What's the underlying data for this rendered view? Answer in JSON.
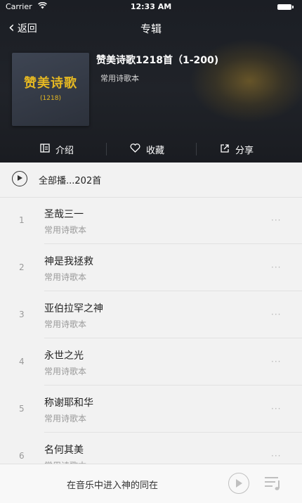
{
  "status": {
    "carrier": "Carrier",
    "time": "12:33 AM",
    "wifi_icon": "wifi-icon",
    "battery_icon": "battery-icon"
  },
  "nav": {
    "back_label": "返回",
    "title": "专辑"
  },
  "album": {
    "cover_title": "赞美诗歌",
    "cover_sub": "(1218)",
    "title": "赞美诗歌1218首（1-200)",
    "author": "常用诗歌本"
  },
  "actions": [
    {
      "label": "介绍",
      "icon": "book-icon"
    },
    {
      "label": "收藏",
      "icon": "heart-icon"
    },
    {
      "label": "分享",
      "icon": "share-icon"
    }
  ],
  "playall": {
    "label": "全部播...202首"
  },
  "songs": [
    {
      "num": "1",
      "title": "圣哉三一",
      "sub": "常用诗歌本"
    },
    {
      "num": "2",
      "title": "神是我拯救",
      "sub": "常用诗歌本"
    },
    {
      "num": "3",
      "title": "亚伯拉罕之神",
      "sub": "常用诗歌本"
    },
    {
      "num": "4",
      "title": "永世之光",
      "sub": "常用诗歌本"
    },
    {
      "num": "5",
      "title": "称谢耶和华",
      "sub": "常用诗歌本"
    },
    {
      "num": "6",
      "title": "名何其美",
      "sub": "常用诗歌本"
    }
  ],
  "more_glyph": "···",
  "player": {
    "text": "在音乐中进入神的同在"
  },
  "colors": {
    "header_bg": "#1f2228",
    "accent_gold": "#e4b722",
    "list_bg": "#f2f2f2"
  }
}
